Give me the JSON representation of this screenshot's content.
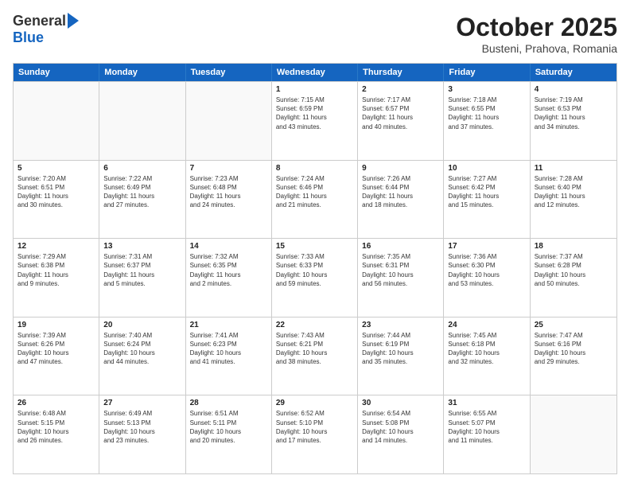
{
  "header": {
    "logo_general": "General",
    "logo_blue": "Blue",
    "month_title": "October 2025",
    "subtitle": "Busteni, Prahova, Romania"
  },
  "days_of_week": [
    "Sunday",
    "Monday",
    "Tuesday",
    "Wednesday",
    "Thursday",
    "Friday",
    "Saturday"
  ],
  "weeks": [
    [
      {
        "day": "",
        "content": ""
      },
      {
        "day": "",
        "content": ""
      },
      {
        "day": "",
        "content": ""
      },
      {
        "day": "1",
        "content": "Sunrise: 7:15 AM\nSunset: 6:59 PM\nDaylight: 11 hours\nand 43 minutes."
      },
      {
        "day": "2",
        "content": "Sunrise: 7:17 AM\nSunset: 6:57 PM\nDaylight: 11 hours\nand 40 minutes."
      },
      {
        "day": "3",
        "content": "Sunrise: 7:18 AM\nSunset: 6:55 PM\nDaylight: 11 hours\nand 37 minutes."
      },
      {
        "day": "4",
        "content": "Sunrise: 7:19 AM\nSunset: 6:53 PM\nDaylight: 11 hours\nand 34 minutes."
      }
    ],
    [
      {
        "day": "5",
        "content": "Sunrise: 7:20 AM\nSunset: 6:51 PM\nDaylight: 11 hours\nand 30 minutes."
      },
      {
        "day": "6",
        "content": "Sunrise: 7:22 AM\nSunset: 6:49 PM\nDaylight: 11 hours\nand 27 minutes."
      },
      {
        "day": "7",
        "content": "Sunrise: 7:23 AM\nSunset: 6:48 PM\nDaylight: 11 hours\nand 24 minutes."
      },
      {
        "day": "8",
        "content": "Sunrise: 7:24 AM\nSunset: 6:46 PM\nDaylight: 11 hours\nand 21 minutes."
      },
      {
        "day": "9",
        "content": "Sunrise: 7:26 AM\nSunset: 6:44 PM\nDaylight: 11 hours\nand 18 minutes."
      },
      {
        "day": "10",
        "content": "Sunrise: 7:27 AM\nSunset: 6:42 PM\nDaylight: 11 hours\nand 15 minutes."
      },
      {
        "day": "11",
        "content": "Sunrise: 7:28 AM\nSunset: 6:40 PM\nDaylight: 11 hours\nand 12 minutes."
      }
    ],
    [
      {
        "day": "12",
        "content": "Sunrise: 7:29 AM\nSunset: 6:38 PM\nDaylight: 11 hours\nand 9 minutes."
      },
      {
        "day": "13",
        "content": "Sunrise: 7:31 AM\nSunset: 6:37 PM\nDaylight: 11 hours\nand 5 minutes."
      },
      {
        "day": "14",
        "content": "Sunrise: 7:32 AM\nSunset: 6:35 PM\nDaylight: 11 hours\nand 2 minutes."
      },
      {
        "day": "15",
        "content": "Sunrise: 7:33 AM\nSunset: 6:33 PM\nDaylight: 10 hours\nand 59 minutes."
      },
      {
        "day": "16",
        "content": "Sunrise: 7:35 AM\nSunset: 6:31 PM\nDaylight: 10 hours\nand 56 minutes."
      },
      {
        "day": "17",
        "content": "Sunrise: 7:36 AM\nSunset: 6:30 PM\nDaylight: 10 hours\nand 53 minutes."
      },
      {
        "day": "18",
        "content": "Sunrise: 7:37 AM\nSunset: 6:28 PM\nDaylight: 10 hours\nand 50 minutes."
      }
    ],
    [
      {
        "day": "19",
        "content": "Sunrise: 7:39 AM\nSunset: 6:26 PM\nDaylight: 10 hours\nand 47 minutes."
      },
      {
        "day": "20",
        "content": "Sunrise: 7:40 AM\nSunset: 6:24 PM\nDaylight: 10 hours\nand 44 minutes."
      },
      {
        "day": "21",
        "content": "Sunrise: 7:41 AM\nSunset: 6:23 PM\nDaylight: 10 hours\nand 41 minutes."
      },
      {
        "day": "22",
        "content": "Sunrise: 7:43 AM\nSunset: 6:21 PM\nDaylight: 10 hours\nand 38 minutes."
      },
      {
        "day": "23",
        "content": "Sunrise: 7:44 AM\nSunset: 6:19 PM\nDaylight: 10 hours\nand 35 minutes."
      },
      {
        "day": "24",
        "content": "Sunrise: 7:45 AM\nSunset: 6:18 PM\nDaylight: 10 hours\nand 32 minutes."
      },
      {
        "day": "25",
        "content": "Sunrise: 7:47 AM\nSunset: 6:16 PM\nDaylight: 10 hours\nand 29 minutes."
      }
    ],
    [
      {
        "day": "26",
        "content": "Sunrise: 6:48 AM\nSunset: 5:15 PM\nDaylight: 10 hours\nand 26 minutes."
      },
      {
        "day": "27",
        "content": "Sunrise: 6:49 AM\nSunset: 5:13 PM\nDaylight: 10 hours\nand 23 minutes."
      },
      {
        "day": "28",
        "content": "Sunrise: 6:51 AM\nSunset: 5:11 PM\nDaylight: 10 hours\nand 20 minutes."
      },
      {
        "day": "29",
        "content": "Sunrise: 6:52 AM\nSunset: 5:10 PM\nDaylight: 10 hours\nand 17 minutes."
      },
      {
        "day": "30",
        "content": "Sunrise: 6:54 AM\nSunset: 5:08 PM\nDaylight: 10 hours\nand 14 minutes."
      },
      {
        "day": "31",
        "content": "Sunrise: 6:55 AM\nSunset: 5:07 PM\nDaylight: 10 hours\nand 11 minutes."
      },
      {
        "day": "",
        "content": ""
      }
    ]
  ]
}
